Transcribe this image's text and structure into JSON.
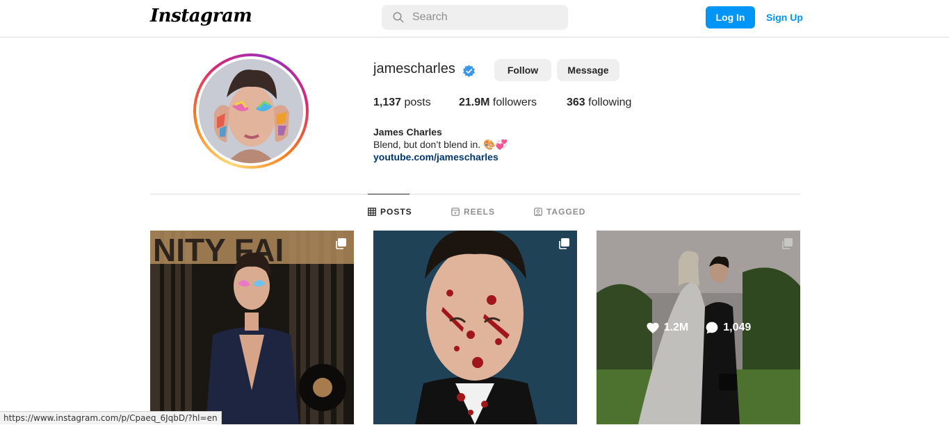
{
  "header": {
    "logo": "Instagram",
    "search_placeholder": "Search",
    "login_label": "Log In",
    "signup_label": "Sign Up"
  },
  "profile": {
    "username": "jamescharles",
    "verified": true,
    "follow_label": "Follow",
    "message_label": "Message",
    "posts_count": "1,137",
    "posts_label": "posts",
    "followers_count": "21.9M",
    "followers_label": "followers",
    "following_count": "363",
    "following_label": "following",
    "full_name": "James Charles",
    "bio": "Blend, but don’t blend in. 🎨💞",
    "link": "youtube.com/jamescharles"
  },
  "tabs": [
    {
      "label": "POSTS",
      "icon": "grid-icon",
      "active": true
    },
    {
      "label": "REELS",
      "icon": "reels-icon",
      "active": false
    },
    {
      "label": "TAGGED",
      "icon": "tagged-icon",
      "active": false
    }
  ],
  "posts": [
    {
      "multi": true
    },
    {
      "multi": true
    },
    {
      "multi": true,
      "hovered": true,
      "likes": "1.2M",
      "comments": "1,049"
    }
  ],
  "status_url": "https://www.instagram.com/p/Cpaeq_6JqbD/?hl=en",
  "colors": {
    "accent": "#0095f6",
    "link": "#00376b",
    "border": "#dbdbdb"
  }
}
